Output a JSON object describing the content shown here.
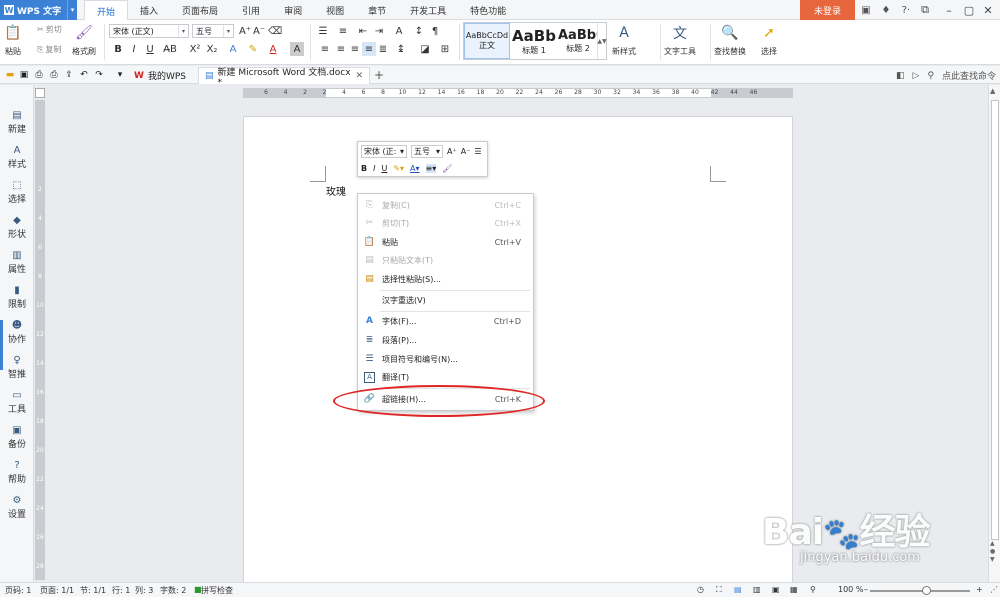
{
  "app": {
    "title": "WPS 文字"
  },
  "tabs": [
    "开始",
    "插入",
    "页面布局",
    "引用",
    "审阅",
    "视图",
    "章节",
    "开发工具",
    "特色功能"
  ],
  "login": "未登录",
  "ribbon": {
    "paste": "粘贴",
    "cut": "剪切",
    "copy": "复制",
    "format_painter": "格式刷",
    "font_name": "宋体 (正文)",
    "font_size": "五号",
    "styles": [
      {
        "preview": "AaBbCcDd",
        "label": "正文"
      },
      {
        "preview": "AaBb",
        "label": "标题 1"
      },
      {
        "preview": "AaBbC",
        "label": "标题 2"
      }
    ],
    "new_style": "新样式",
    "text_tools": "文字工具",
    "find_replace": "查找替换",
    "select": "选择"
  },
  "quickbar": {
    "tab_home": "我的WPS",
    "tab_doc": "新建 Microsoft Word 文档.docx *",
    "search_hint": "点此查找命令"
  },
  "sidebar": [
    "新建",
    "样式",
    "选择",
    "形状",
    "属性",
    "限制",
    "协作",
    "智推",
    "工具",
    "备份",
    "帮助",
    "设置"
  ],
  "ruler": {
    "h_numbers": [
      "6",
      "4",
      "2",
      "2",
      "4",
      "6",
      "8",
      "10",
      "12",
      "14",
      "16",
      "18",
      "20",
      "22",
      "24",
      "26",
      "28",
      "30",
      "32",
      "34",
      "36",
      "38",
      "40",
      "42",
      "44",
      "46"
    ],
    "v_numbers": [
      "2",
      "4",
      "6",
      "8",
      "10",
      "12",
      "14",
      "16",
      "18",
      "20",
      "22",
      "24",
      "26",
      "28"
    ]
  },
  "document": {
    "text": "玫瑰"
  },
  "minibar": {
    "font": "宋体 (正:",
    "size": "五号"
  },
  "context_menu": [
    {
      "label": "复制(C)",
      "shortcut": "Ctrl+C",
      "disabled": true,
      "icon": "copy-icon"
    },
    {
      "label": "剪切(T)",
      "shortcut": "Ctrl+X",
      "disabled": true,
      "icon": "scissors-icon"
    },
    {
      "label": "粘贴",
      "shortcut": "Ctrl+V",
      "disabled": false,
      "icon": "paste-icon"
    },
    {
      "label": "只粘贴文本(T)",
      "shortcut": "",
      "disabled": true,
      "icon": "paste-text-icon"
    },
    {
      "label": "选择性粘贴(S)...",
      "shortcut": "",
      "disabled": false,
      "icon": "paste-special-icon"
    },
    {
      "label": "汉字重选(V)",
      "shortcut": "",
      "disabled": false,
      "icon": ""
    },
    {
      "label": "字体(F)...",
      "shortcut": "Ctrl+D",
      "disabled": false,
      "icon": "font-icon"
    },
    {
      "label": "段落(P)...",
      "shortcut": "",
      "disabled": false,
      "icon": "paragraph-icon"
    },
    {
      "label": "项目符号和编号(N)...",
      "shortcut": "",
      "disabled": false,
      "icon": "list-icon"
    },
    {
      "label": "翻译(T)",
      "shortcut": "",
      "disabled": false,
      "icon": "translate-icon"
    },
    {
      "label": "超链接(H)...",
      "shortcut": "Ctrl+K",
      "disabled": false,
      "icon": "hyperlink-icon"
    }
  ],
  "status": {
    "page": "页码: 1",
    "pages": "页面: 1/1",
    "section": "节: 1/1",
    "row": "行: 1",
    "col": "列: 3",
    "words": "字数: 2",
    "spell": "拼写检查",
    "zoom": "100 %"
  },
  "watermark": {
    "brand": "Bai",
    "brand2": "经验",
    "url": "jingyan.baidu.com"
  },
  "colors": {
    "accent": "#3b82d6",
    "login": "#e8663d",
    "highlight_circle": "#e02424"
  }
}
